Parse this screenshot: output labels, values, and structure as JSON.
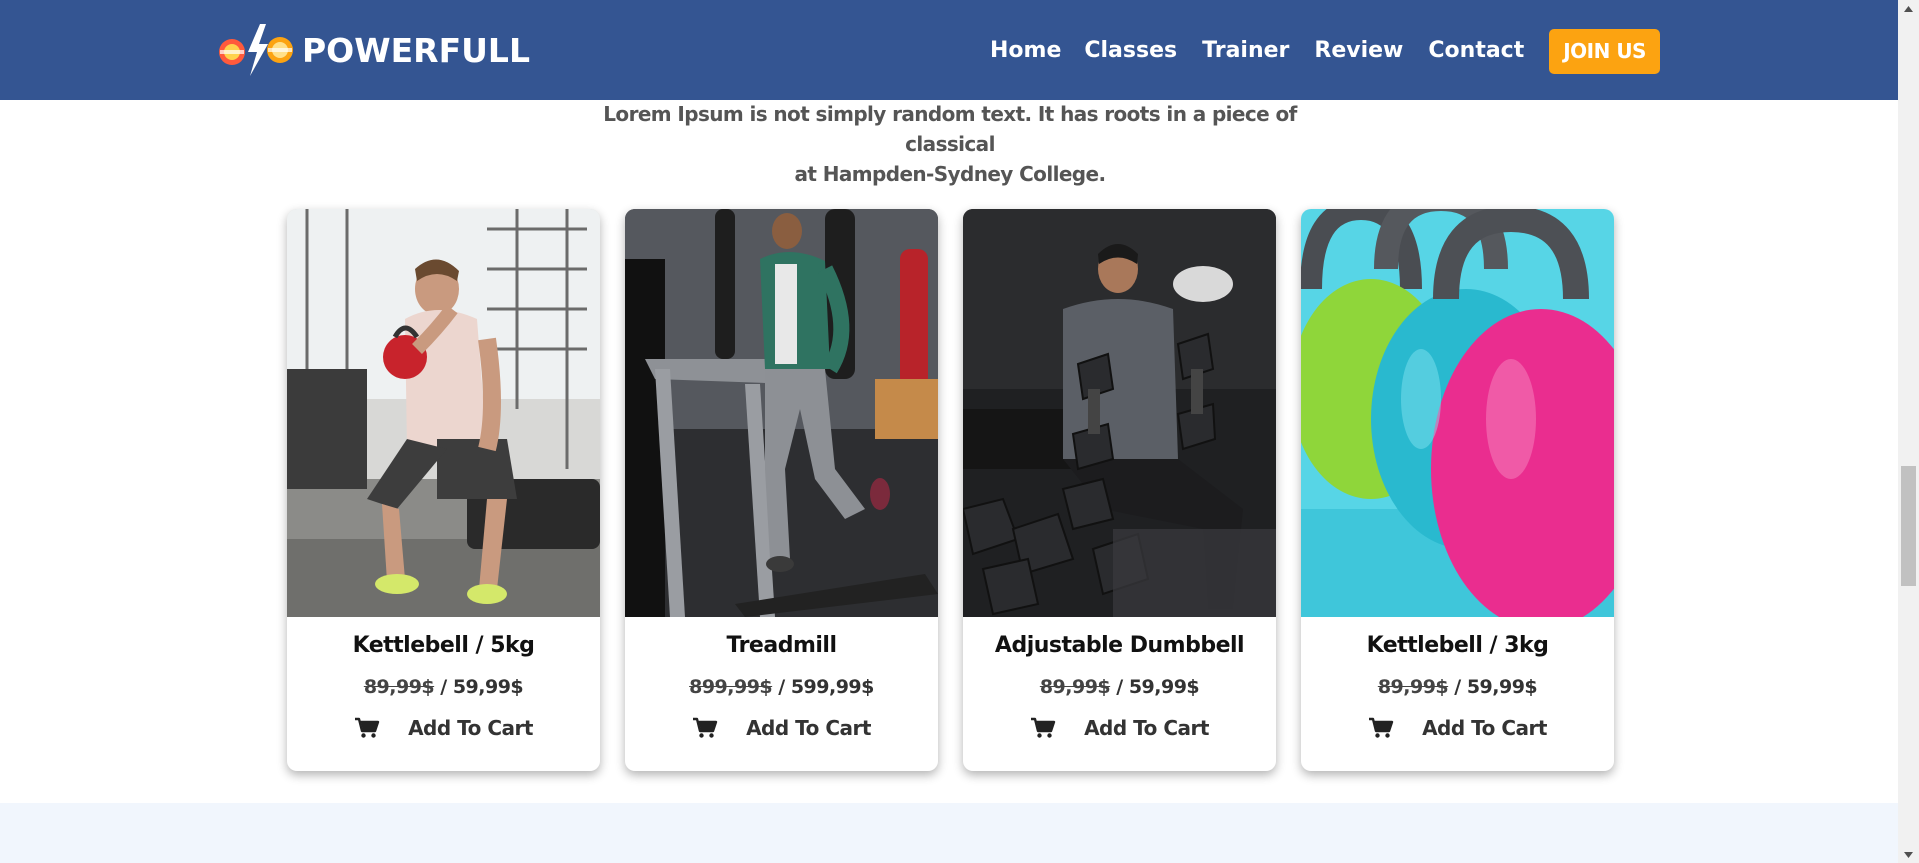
{
  "brand": {
    "name": "POWERFULL",
    "colors": {
      "nav_bg": "#345592",
      "accent": "#fca311",
      "band": "#f1f6fd"
    }
  },
  "nav": {
    "items": [
      "Home",
      "Classes",
      "Trainer",
      "Review",
      "Contact"
    ],
    "cta": "JOIN US"
  },
  "intro": {
    "line1": "Lorem Ipsum is not simply random text. It has roots in a piece of classical",
    "line2": "at Hampden-Sydney College."
  },
  "products": [
    {
      "title": "Kettlebell / 5kg",
      "old_price": "89,99$",
      "separator": " / ",
      "new_price": "59,99$",
      "cart_label": "Add To Cart",
      "image": "man-with-kettlebell-photo"
    },
    {
      "title": "Treadmill",
      "old_price": "899,99$",
      "separator": " / ",
      "new_price": "599,99$",
      "cart_label": "Add To Cart",
      "image": "man-on-treadmill-photo"
    },
    {
      "title": "Adjustable Dumbbell",
      "old_price": "89,99$",
      "separator": " / ",
      "new_price": "59,99$",
      "cart_label": "Add To Cart",
      "image": "man-with-dumbbells-photo"
    },
    {
      "title": "Kettlebell / 3kg",
      "old_price": "89,99$",
      "separator": " / ",
      "new_price": "59,99$",
      "cart_label": "Add To Cart",
      "image": "colored-kettlebells-photo"
    }
  ],
  "icons": {
    "cart": "cart-icon",
    "logo": "logo-mark-icon"
  }
}
